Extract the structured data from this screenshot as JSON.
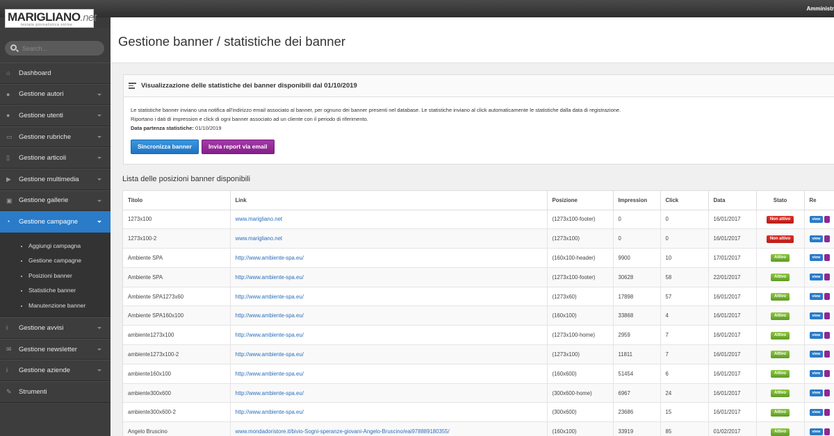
{
  "topbar": {
    "user": "Amministr"
  },
  "logo": {
    "main": "MARIGLIANO",
    "net": ".net",
    "tagline": "testata giornalistica online"
  },
  "search": {
    "placeholder": "Search..."
  },
  "menu": [
    {
      "label": "Dashboard",
      "icon": "home-icon",
      "glyph": "⌂",
      "caret": false
    },
    {
      "label": "Gestione autori",
      "icon": "user-icon",
      "glyph": "●",
      "caret": true
    },
    {
      "label": "Gestione utenti",
      "icon": "user-icon",
      "glyph": "●",
      "caret": true
    },
    {
      "label": "Gestione rubriche",
      "icon": "folder-icon",
      "glyph": "▭",
      "caret": true
    },
    {
      "label": "Gestione articoli",
      "icon": "document-icon",
      "glyph": "▯",
      "caret": true
    },
    {
      "label": "Gestione multimedia",
      "icon": "play-icon",
      "glyph": "▶",
      "caret": true
    },
    {
      "label": "Gestione gallerie",
      "icon": "image-icon",
      "glyph": "▣",
      "caret": true
    },
    {
      "label": "Gestione campagne",
      "icon": "chart-pie-icon",
      "glyph": "◔",
      "caret": true,
      "active": true
    }
  ],
  "submenu": [
    "Aggiungi campagna",
    "Gestione campagne",
    "Posizioni banner",
    "Statistiche banner",
    "Manutenzione banner"
  ],
  "menu_bottom": [
    {
      "label": "Gestione avvisi",
      "icon": "info-icon",
      "glyph": "i",
      "caret": true
    },
    {
      "label": "Gestione newsletter",
      "icon": "envelope-icon",
      "glyph": "✉",
      "caret": true
    },
    {
      "label": "Gestione aziende",
      "icon": "info-icon",
      "glyph": "i",
      "caret": true
    },
    {
      "label": "Strumenti",
      "icon": "wrench-icon",
      "glyph": "✎",
      "caret": false
    }
  ],
  "page": {
    "title": "Gestione banner / statistiche dei banner"
  },
  "panel": {
    "title": "Visualizzazione delle statistiche dei banner disponibili dal 01/10/2019",
    "line1": "Le statistiche banner inviano una notifica all'indirizzo email associato al banner, per ognuno dei banner presenti nel database. Le statistiche inviano al click automaticamente le statistiche dalla data di registrazione.",
    "line2": "Riportano i dati di impression e click di ogni banner associato ad un cliente con il periodo di riferimento.",
    "start_label": "Data partenza statistiche:",
    "start_value": "01/10/2019",
    "sync_button": "Sincronizza banner",
    "report_button": "Invia report via email"
  },
  "list": {
    "title": "Lista delle posizioni banner disponibili",
    "columns": [
      "Titolo",
      "Link",
      "Posizione",
      "Impression",
      "Click",
      "Data",
      "Stato",
      "Re"
    ],
    "view_label": "view",
    "rows": [
      {
        "titolo": "1273x100",
        "link": "www.marigliano.net",
        "posizione": "(1273x100-footer)",
        "impression": "0",
        "click": "0",
        "data": "16/01/2017",
        "stato": "Non attivo",
        "active": false
      },
      {
        "titolo": "1273x100-2",
        "link": "www.marigliano.net",
        "posizione": "(1273x100)",
        "impression": "0",
        "click": "0",
        "data": "16/01/2017",
        "stato": "Non attivo",
        "active": false
      },
      {
        "titolo": "Ambiente SPA",
        "link": "http://www.ambiente-spa.eu/",
        "posizione": "(160x100-header)",
        "impression": "9900",
        "click": "10",
        "data": "17/01/2017",
        "stato": "Attivo",
        "active": true
      },
      {
        "titolo": "Ambiente SPA",
        "link": "http://www.ambiente-spa.eu/",
        "posizione": "(1273x100-footer)",
        "impression": "30628",
        "click": "58",
        "data": "22/01/2017",
        "stato": "Attivo",
        "active": true
      },
      {
        "titolo": "Ambiente SPA1273x60",
        "link": "http://www.ambiente-spa.eu/",
        "posizione": "(1273x60)",
        "impression": "17898",
        "click": "57",
        "data": "16/01/2017",
        "stato": "Attivo",
        "active": true
      },
      {
        "titolo": "Ambiente SPA160x100",
        "link": "http://www.ambiente-spa.eu/",
        "posizione": "(160x100)",
        "impression": "33868",
        "click": "4",
        "data": "16/01/2017",
        "stato": "Attivo",
        "active": true
      },
      {
        "titolo": "ambiente1273x100",
        "link": "http://www.ambiente-spa.eu/",
        "posizione": "(1273x100-home)",
        "impression": "2959",
        "click": "7",
        "data": "16/01/2017",
        "stato": "Attivo",
        "active": true
      },
      {
        "titolo": "ambiente1273x100-2",
        "link": "http://www.ambiente-spa.eu/",
        "posizione": "(1273x100)",
        "impression": "11811",
        "click": "7",
        "data": "16/01/2017",
        "stato": "Attivo",
        "active": true
      },
      {
        "titolo": "ambiente160x100",
        "link": "http://www.ambiente-spa.eu/",
        "posizione": "(160x600)",
        "impression": "51454",
        "click": "6",
        "data": "16/01/2017",
        "stato": "Attivo",
        "active": true
      },
      {
        "titolo": "ambiente300x600",
        "link": "http://www.ambiente-spa.eu/",
        "posizione": "(300x600-home)",
        "impression": "6967",
        "click": "24",
        "data": "16/01/2017",
        "stato": "Attivo",
        "active": true
      },
      {
        "titolo": "ambiente300x600-2",
        "link": "http://www.ambiente-spa.eu/",
        "posizione": "(300x600)",
        "impression": "23686",
        "click": "15",
        "data": "16/01/2017",
        "stato": "Attivo",
        "active": true
      },
      {
        "titolo": "Angelo Bruscino",
        "link": "www.mondadoristore.it/bivio-Sogni-speranze-giovani-Angelo-Bruscino/eai978889180355/",
        "posizione": "(160x100)",
        "impression": "33919",
        "click": "85",
        "data": "01/02/2017",
        "stato": "Attivo",
        "active": true
      }
    ]
  }
}
